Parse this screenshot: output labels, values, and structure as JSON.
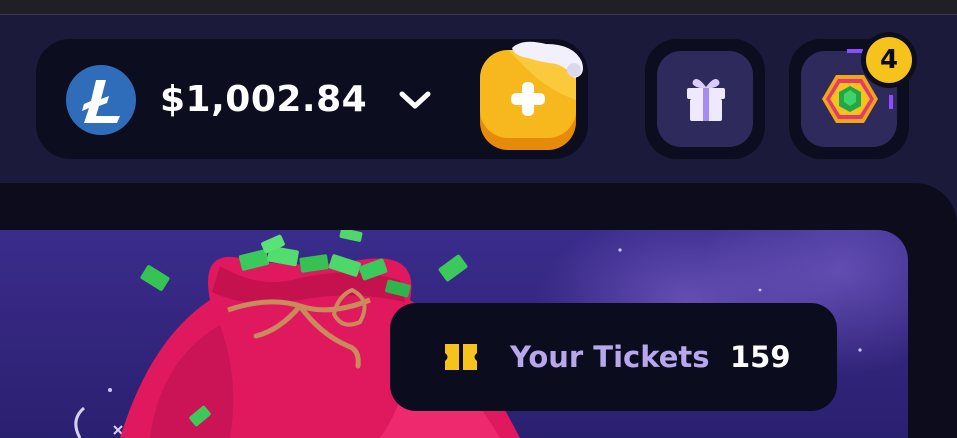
{
  "wallet": {
    "currency_icon": "litecoin-icon",
    "balance": "$1,002.84",
    "dropdown_icon": "chevron-down-icon",
    "deposit_icon": "plus-icon"
  },
  "header_buttons": {
    "gift_icon": "gift-icon",
    "rank_icon": "emerald-rank-icon",
    "notification_count": "4"
  },
  "tickets": {
    "icon": "ticket-icon",
    "label": "Your Tickets",
    "count": "159"
  },
  "colors": {
    "accent_yellow": "#f6c21c",
    "litecoin_blue": "#2f6dbb",
    "panel_dark": "#0c0d1f",
    "header_bg": "#1b1a3a",
    "tickets_label": "#b9a7ee",
    "banner_purple": "#3a2c8c",
    "bag_pink": "#e0195f"
  }
}
